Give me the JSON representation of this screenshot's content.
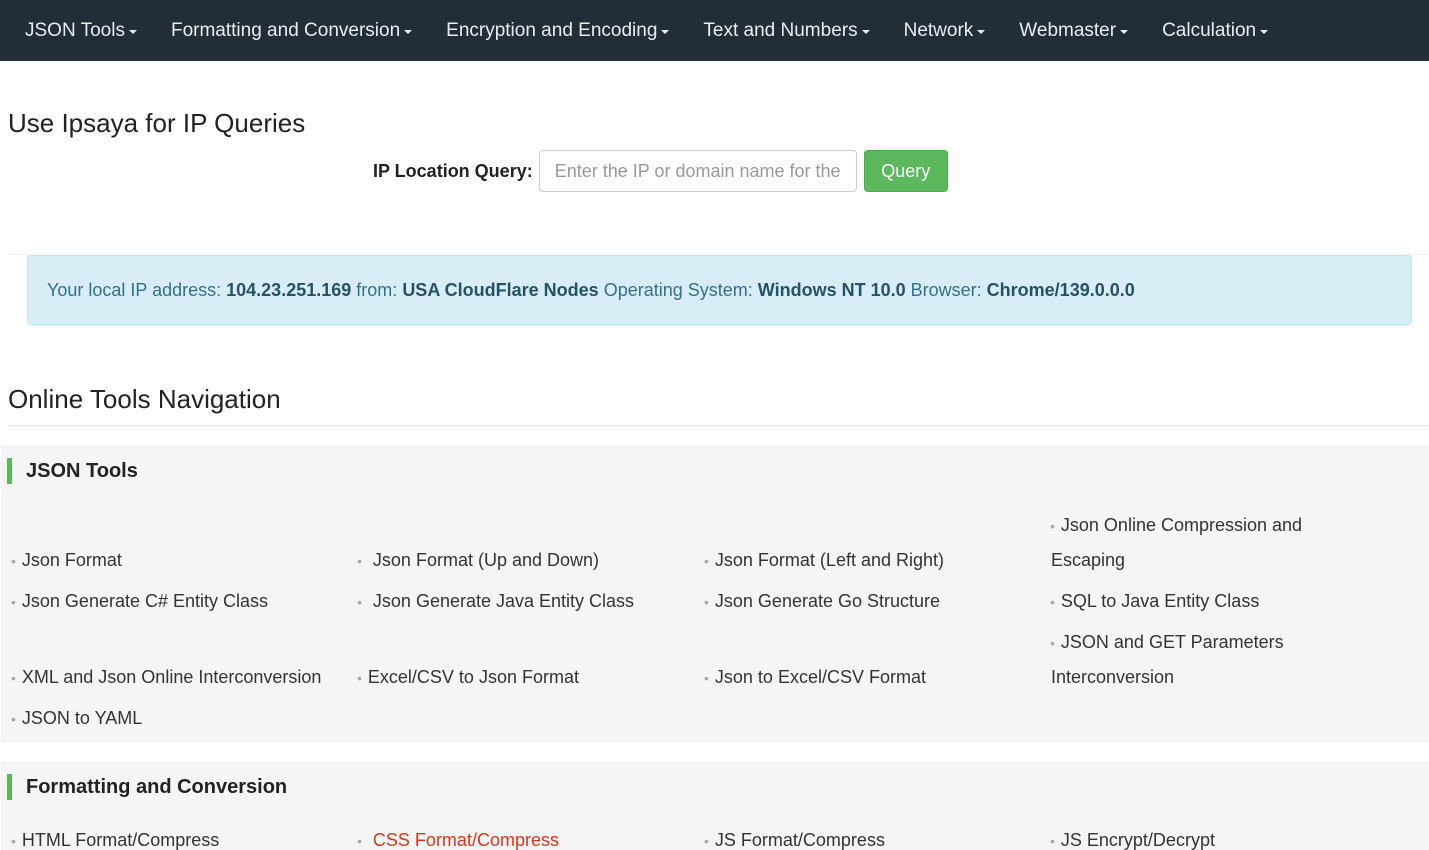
{
  "nav": [
    {
      "label": "JSON Tools"
    },
    {
      "label": "Formatting and Conversion"
    },
    {
      "label": "Encryption and Encoding"
    },
    {
      "label": "Text and Numbers"
    },
    {
      "label": "Network"
    },
    {
      "label": "Webmaster"
    },
    {
      "label": "Calculation"
    }
  ],
  "page_title": "Use Ipsaya for IP Queries",
  "query": {
    "label": "IP Location Query:",
    "placeholder": "Enter the IP or domain name for the query",
    "button": "Query"
  },
  "ip_info": {
    "prefix": "Your local IP address: ",
    "ip": "104.23.251.169",
    "from_label": " from: ",
    "location": "USA CloudFlare Nodes",
    "os_label": " Operating System: ",
    "os": "Windows NT 10.0",
    "browser_label": " Browser: ",
    "browser": "Chrome/139.0.0.0"
  },
  "section_title": "Online Tools Navigation",
  "json_tools": {
    "title": "JSON Tools",
    "items": [
      "Json Format",
      "Json Format (Up and Down)",
      "Json Format (Left and Right)",
      "Json Online Compression and",
      "Escaping",
      "Json Generate C# Entity Class",
      "Json Generate Java Entity Class",
      "Json Generate Go Structure",
      "SQL to Java Entity Class",
      "JSON and GET Parameters",
      "Interconversion",
      "XML and Json Online Interconversion",
      "Excel/CSV to Json Format",
      "Json to Excel/CSV Format",
      "JSON to YAML"
    ]
  },
  "formatting": {
    "title": "Formatting and Conversion",
    "items": [
      "HTML Format/Compress",
      "CSS Format/Compress",
      "JS Format/Compress",
      "JS Encrypt/Decrypt"
    ]
  },
  "colors": {
    "nav_bg": "#222d38",
    "accent_green": "#5cb85c",
    "alert_bg": "#d9edf7",
    "active_link": "#e0351a"
  }
}
